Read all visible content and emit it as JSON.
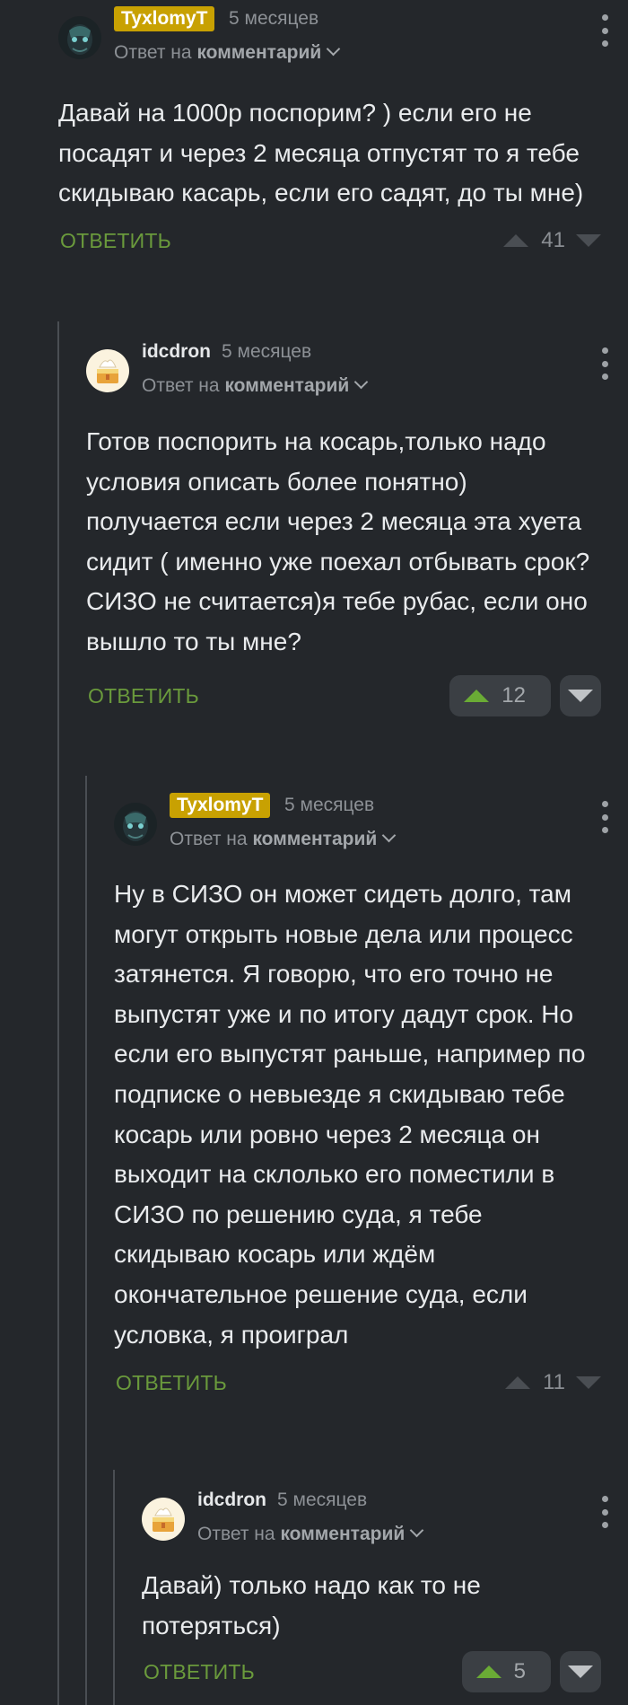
{
  "comments": [
    {
      "author": "TyxlomyT",
      "time": "5 месяцев",
      "reply_prefix": "Ответ на",
      "reply_target": "комментарий",
      "text": "Давай на 1000р поспорим? ) если его не посадят и через 2 месяца отпустят то я тебе скидываю касарь, если его садят, до ты мне)",
      "reply_label": "ОТВЕТИТЬ",
      "score": "41",
      "voted": false
    },
    {
      "author": "idcdron",
      "time": "5 месяцев",
      "reply_prefix": "Ответ на",
      "reply_target": "комментарий",
      "text": "Готов поспорить на косарь,только надо условия описать более понятно) получается если через 2 месяца эта хуета сидит ( именно уже поехал отбывать срок? СИЗО не считается)я тебе рубас, если оно вышло то ты мне?",
      "reply_label": "ОТВЕТИТЬ",
      "score": "12",
      "voted": true
    },
    {
      "author": "TyxlomyT",
      "time": "5 месяцев",
      "reply_prefix": "Ответ на",
      "reply_target": "комментарий",
      "text": "Ну в СИЗО он может сидеть долго, там могут открыть новые дела или процесс затянется. Я говорю, что его точно не выпустят уже и по итогу дадут срок. Но если его выпустят раньше, например по подписке о невыезде я скидываю тебе косарь или ровно через 2 месяца он выходит на склолько его поместили в СИЗО по решению суда, я тебе скидываю косарь или ждём окончательное решение суда, если условка, я проиграл",
      "reply_label": "ОТВЕТИТЬ",
      "score": "11",
      "voted": false
    },
    {
      "author": "idcdron",
      "time": "5 месяцев",
      "reply_prefix": "Ответ на",
      "reply_target": "комментарий",
      "text": "Давай) только надо как то не потеряться)",
      "reply_label": "ОТВЕТИТЬ",
      "score": "5",
      "voted": true
    }
  ],
  "colors": {
    "background": "#24272b",
    "author_badge": "#c8a102",
    "reply_green": "#6a9a3c",
    "upvote_green": "#6aab35"
  },
  "icons": {
    "avatar_tyxlomyt": "dark-mask-avatar",
    "avatar_idcdron": "cake-avatar",
    "more": "vertical-dots-icon",
    "upvote": "triangle-up-icon",
    "downvote": "triangle-down-icon",
    "expand": "chevron-down-icon"
  }
}
